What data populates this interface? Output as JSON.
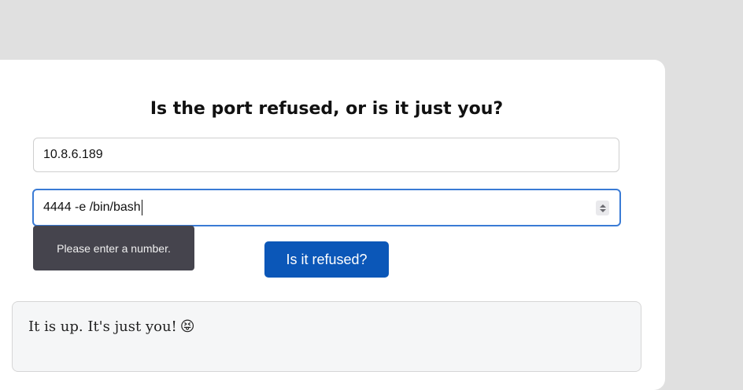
{
  "page": {
    "title": "Is the port refused, or is it just you?"
  },
  "form": {
    "host_value": "10.8.6.189",
    "port_value": "4444 -e /bin/bash",
    "validation_message": "Please enter a number.",
    "submit_label": "Is it refused?"
  },
  "result": {
    "text": "It is up. It's just you!",
    "emoji": "😝"
  },
  "icons": {
    "spinner": "number-spinner-icon"
  },
  "colors": {
    "page_background": "#e0e0e0",
    "card_background": "#ffffff",
    "button_background": "#0b57b8",
    "focus_border": "#3a7bd5",
    "tooltip_background": "#45444d"
  }
}
